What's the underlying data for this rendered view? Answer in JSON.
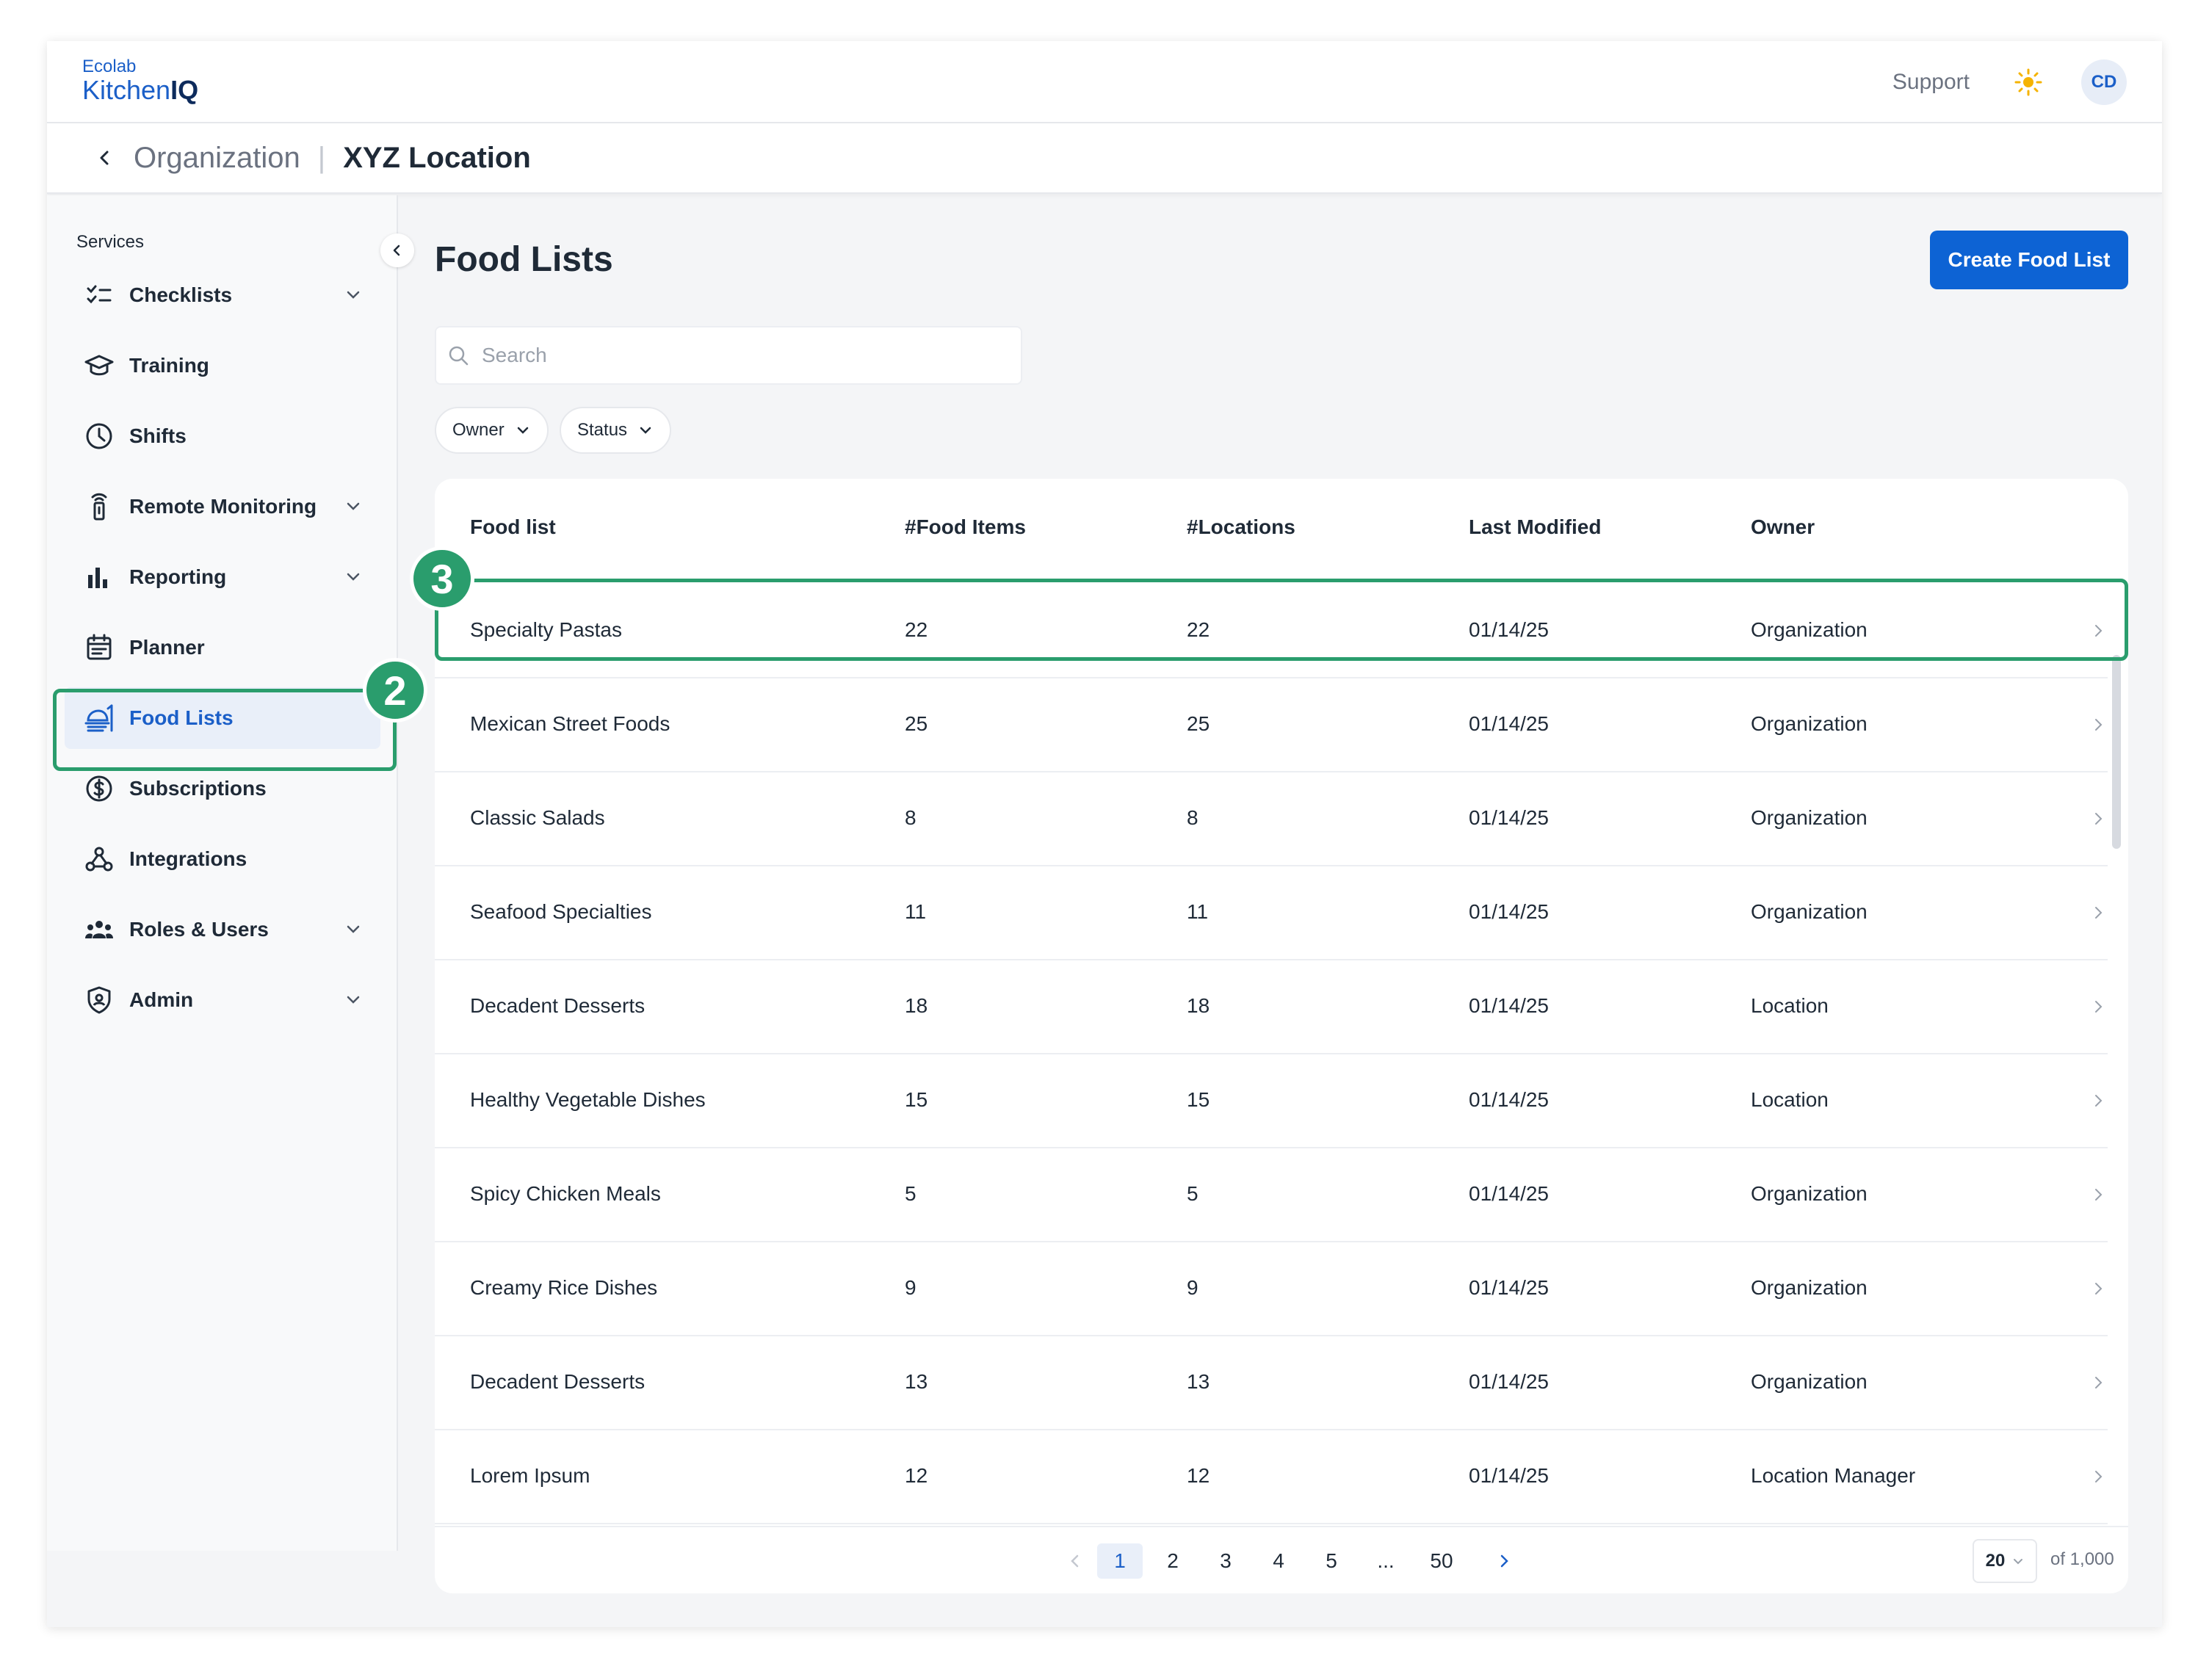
{
  "header": {
    "logo_top": "Ecolab",
    "logo_main": "Kitchen",
    "logo_bold": "IQ",
    "support": "Support",
    "avatar": "CD"
  },
  "breadcrumb": {
    "parent": "Organization",
    "separator": "|",
    "current": "XYZ Location"
  },
  "sidebar": {
    "section": "Services",
    "items": [
      {
        "label": "Checklists",
        "icon": "checklist-icon",
        "expandable": true
      },
      {
        "label": "Training",
        "icon": "graduation-cap-icon",
        "expandable": false
      },
      {
        "label": "Shifts",
        "icon": "clock-icon",
        "expandable": false
      },
      {
        "label": "Remote Monitoring",
        "icon": "sensor-icon",
        "expandable": true
      },
      {
        "label": "Reporting",
        "icon": "bar-chart-icon",
        "expandable": true
      },
      {
        "label": "Planner",
        "icon": "calendar-icon",
        "expandable": false
      },
      {
        "label": "Food Lists",
        "icon": "food-list-icon",
        "expandable": false,
        "active": true
      },
      {
        "label": "Subscriptions",
        "icon": "dollar-icon",
        "expandable": false
      },
      {
        "label": "Integrations",
        "icon": "webhook-icon",
        "expandable": false
      },
      {
        "label": "Roles & Users",
        "icon": "users-icon",
        "expandable": true
      },
      {
        "label": "Admin",
        "icon": "shield-icon",
        "expandable": true
      }
    ]
  },
  "main": {
    "title": "Food Lists",
    "create_button": "Create Food List",
    "search_placeholder": "Search",
    "filters": [
      "Owner",
      "Status"
    ]
  },
  "table": {
    "columns": [
      "Food list",
      "#Food Items",
      "#Locations",
      "Last Modified",
      "Owner"
    ],
    "rows": [
      [
        "Specialty Pastas",
        "22",
        "22",
        "01/14/25",
        "Organization"
      ],
      [
        "Mexican Street Foods",
        "25",
        "25",
        "01/14/25",
        "Organization"
      ],
      [
        "Classic Salads",
        "8",
        "8",
        "01/14/25",
        "Organization"
      ],
      [
        "Seafood Specialties",
        "11",
        "11",
        "01/14/25",
        "Organization"
      ],
      [
        "Decadent Desserts",
        "18",
        "18",
        "01/14/25",
        "Location"
      ],
      [
        "Healthy Vegetable Dishes",
        "15",
        "15",
        "01/14/25",
        "Location"
      ],
      [
        "Spicy Chicken Meals",
        "5",
        "5",
        "01/14/25",
        "Organization"
      ],
      [
        "Creamy Rice Dishes",
        "9",
        "9",
        "01/14/25",
        "Organization"
      ],
      [
        "Decadent Desserts",
        "13",
        "13",
        "01/14/25",
        "Organization"
      ],
      [
        "Lorem Ipsum",
        "12",
        "12",
        "01/14/25",
        "Location Manager"
      ]
    ]
  },
  "pagination": {
    "pages": [
      "1",
      "2",
      "3",
      "4",
      "5",
      "...",
      "50"
    ],
    "current": "1",
    "page_size": "20",
    "total": "of 1,000"
  },
  "annotations": {
    "step_2": "2",
    "step_3": "3"
  },
  "colors": {
    "primary": "#0d63d4",
    "annotation": "#2a9d6d",
    "active_bg": "#e9eff9"
  }
}
